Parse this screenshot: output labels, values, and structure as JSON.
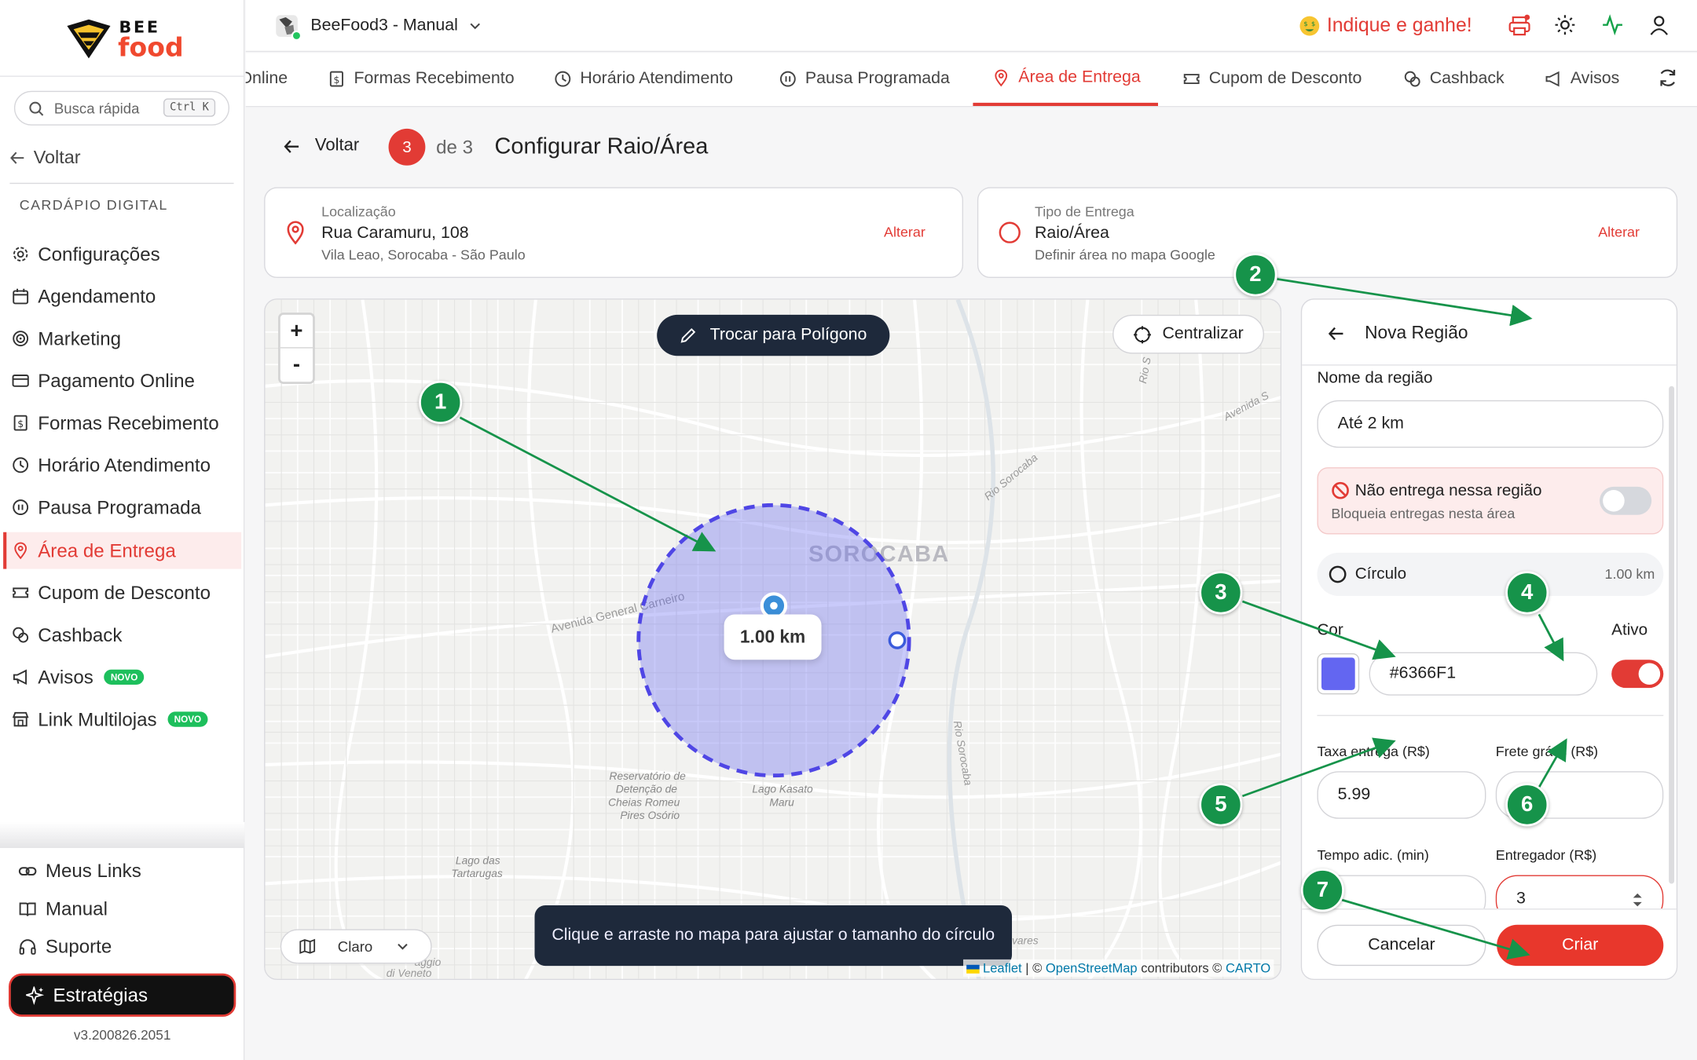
{
  "app": {
    "logo_top": "BEE",
    "logo_bottom": "food",
    "store_name": "BeeFood3 - Manual",
    "indique": "Indique e ganhe!",
    "version": "v3.200826.2051"
  },
  "search": {
    "placeholder": "Busca rápida",
    "shortcut": "Ctrl K"
  },
  "sidebar": {
    "back": "Voltar",
    "section": "CARDÁPIO DIGITAL",
    "items": [
      {
        "label": "Configurações",
        "icon": "gear-icon"
      },
      {
        "label": "Agendamento",
        "icon": "calendar-icon"
      },
      {
        "label": "Marketing",
        "icon": "target-icon"
      },
      {
        "label": "Pagamento Online",
        "icon": "card-icon"
      },
      {
        "label": "Formas Recebimento",
        "icon": "receipt-icon"
      },
      {
        "label": "Horário Atendimento",
        "icon": "clock-icon"
      },
      {
        "label": "Pausa Programada",
        "icon": "pause-icon"
      },
      {
        "label": "Área de Entrega",
        "icon": "pin-icon",
        "active": true
      },
      {
        "label": "Cupom de Desconto",
        "icon": "ticket-icon"
      },
      {
        "label": "Cashback",
        "icon": "coins-icon"
      },
      {
        "label": "Avisos",
        "icon": "megaphone-icon",
        "badge": "NOVO"
      },
      {
        "label": "Link Multilojas",
        "icon": "store-icon",
        "badge": "NOVO"
      }
    ],
    "bottom": [
      {
        "label": "Meus Links",
        "icon": "link-icon"
      },
      {
        "label": "Manual",
        "icon": "book-icon"
      },
      {
        "label": "Suporte",
        "icon": "headset-icon"
      }
    ],
    "strategies": "Estratégias"
  },
  "tabs": [
    {
      "label": "Online",
      "icon": "globe-icon"
    },
    {
      "label": "Formas Recebimento",
      "icon": "receipt-icon"
    },
    {
      "label": "Horário Atendimento",
      "icon": "clock-icon"
    },
    {
      "label": "Pausa Programada",
      "icon": "pause-icon"
    },
    {
      "label": "Área de Entrega",
      "icon": "pin-icon",
      "active": true
    },
    {
      "label": "Cupom de Desconto",
      "icon": "ticket-icon"
    },
    {
      "label": "Cashback",
      "icon": "coins-icon"
    },
    {
      "label": "Avisos",
      "icon": "megaphone-icon"
    }
  ],
  "step": {
    "back": "Voltar",
    "current": "3",
    "of": "de 3",
    "title": "Configurar Raio/Área"
  },
  "location_card": {
    "label": "Localização",
    "value": "Rua Caramuru, 108",
    "sub": "Vila Leao, Sorocaba - São Paulo",
    "action": "Alterar"
  },
  "delivery_card": {
    "label": "Tipo de Entrega",
    "value": "Raio/Área",
    "sub": "Definir área no mapa Google",
    "action": "Alterar"
  },
  "map": {
    "zoom_in": "+",
    "zoom_out": "-",
    "polygon_button": "Trocar para Polígono",
    "center_button": "Centralizar",
    "radius_label": "1.00 km",
    "city_label": "SOROCABA",
    "place_labels": [
      "Avenida General Carneiro",
      "Reservatório de Detenção de Cheias Romeu Pires Osório",
      "Lago Kasato Maru",
      "Lago das Tartarugas",
      "Rio Sorocaba",
      "Avenida S",
      "Rio S",
      "aggio di Veneto",
      "vares"
    ],
    "theme": "Claro",
    "hint": "Clique e arraste no mapa para ajustar o tamanho do círculo",
    "attribution_leaflet": "Leaflet",
    "attribution_osm": "OpenStreetMap",
    "attribution_contrib": "contributors ©",
    "attribution_carto": "CARTO",
    "circle_color": "#6366F1"
  },
  "panel": {
    "title": "Nova Região",
    "name_label": "Nome da região",
    "name_value": "Até 2 km",
    "no_deliver_title": "Não entrega nessa região",
    "no_deliver_sub": "Bloqueia entregas nesta área",
    "no_deliver_on": false,
    "shape_label": "Círculo",
    "shape_value": "1.00 km",
    "color_label": "Cor",
    "color_value": "#6366F1",
    "active_label": "Ativo",
    "active_on": true,
    "fee_label": "Taxa entrega (R$)",
    "fee_value": "5.99",
    "free_label": "Frete grátis (R$)",
    "free_value": "",
    "time_label": "Tempo adic. (min)",
    "time_value": "",
    "courier_label": "Entregador (R$)",
    "courier_value": "3",
    "cancel": "Cancelar",
    "create": "Criar"
  },
  "annotations": [
    "1",
    "2",
    "3",
    "4",
    "5",
    "6",
    "7"
  ],
  "colors": {
    "accent": "#E23B35",
    "annotation": "#16934A",
    "dark": "#1E293B",
    "region": "#6366F1"
  }
}
